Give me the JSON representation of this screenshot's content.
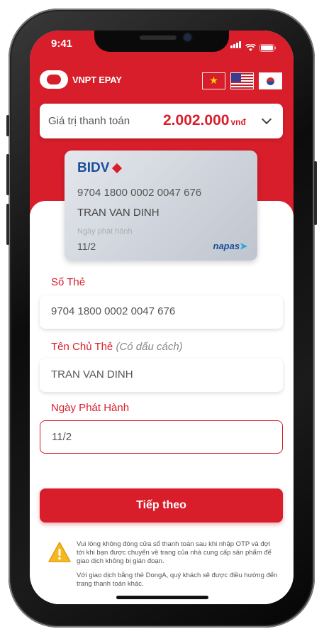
{
  "status_bar": {
    "time": "9:41"
  },
  "brand": {
    "name": "VNPT EPAY",
    "badge": "EPAY"
  },
  "flags": [
    "Vietnam flag",
    "US flag",
    "Korea flag"
  ],
  "payment": {
    "label": "Giá trị thanh toán",
    "amount": "2.002.000",
    "currency": "vnđ"
  },
  "card": {
    "bank": "BIDV",
    "number": "9704 1800 0002 0047 676",
    "holder": "TRAN VAN DINH",
    "issue_label": "Ngày phát hành",
    "issue_date": "11/2",
    "network": "napas"
  },
  "form": {
    "card_number_label": "Số Thẻ",
    "card_number_value": "9704 1800 0002 0047 676",
    "holder_label": "Tên Chủ Thẻ",
    "holder_hint": "(Có dấu cách)",
    "holder_value": "TRAN VAN DINH",
    "issue_label": "Ngày Phát Hành",
    "issue_value": "11/2"
  },
  "actions": {
    "next_label": "Tiếp theo"
  },
  "notice": {
    "line1": "Vui lòng không đóng cửa sổ thanh toán sau khi nhập OTP và đợi tới khi bạn được chuyển về trang của nhà cung cấp sản phẩm để giao dịch không bị gián đoạn.",
    "line2": "Với giao dịch bằng thẻ DongA, quý khách sẽ được điều hướng đến trang thanh toán khác."
  },
  "colors": {
    "accent": "#d81e2b",
    "bank_blue": "#1a4e9b"
  }
}
